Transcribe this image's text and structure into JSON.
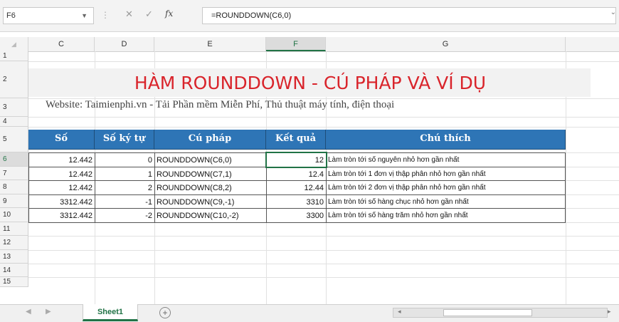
{
  "formula_bar": {
    "name_box": "F6",
    "formula": "=ROUNDDOWN(C6,0)"
  },
  "columns": [
    "C",
    "D",
    "E",
    "F",
    "G"
  ],
  "rows": [
    "1",
    "2",
    "3",
    "4",
    "5",
    "6",
    "7",
    "8",
    "9",
    "10",
    "11",
    "12",
    "13",
    "14",
    "15"
  ],
  "sheet": {
    "title": "HÀM ROUNDDOWN - CÚ PHÁP VÀ VÍ DỤ",
    "website": "Website: Taimienphi.vn - Tải Phần mềm Miễn Phí, Thủ thuật máy tính, điện thoại",
    "table": {
      "headers": [
        "Số",
        "Số ký tự",
        "Cú pháp",
        "Kết quả",
        "Chú thích"
      ],
      "rows": [
        [
          "12.442",
          "0",
          "ROUNDDOWN(C6,0)",
          "12",
          "Làm tròn tới số nguyên nhỏ hơn gần nhất"
        ],
        [
          "12.442",
          "1",
          "ROUNDDOWN(C7,1)",
          "12.4",
          "Làm tròn tới 1 đơn vị thập phân nhỏ hơn gần nhất"
        ],
        [
          "12.442",
          "2",
          "ROUNDDOWN(C8,2)",
          "12.44",
          "Làm tròn tới 2 đơn vị thập phân nhỏ hơn gần nhất"
        ],
        [
          "3312.442",
          "-1",
          "ROUNDDOWN(C9,-1)",
          "3310",
          "Làm tròn tới số hàng chục nhỏ hơn gần nhất"
        ],
        [
          "3312.442",
          "-2",
          "ROUNDDOWN(C10,-2)",
          "3300",
          "Làm tròn tới số hàng trăm nhỏ hơn gần nhất"
        ]
      ]
    }
  },
  "tabs": {
    "active": "Sheet1",
    "add": "+"
  },
  "colors": {
    "accent": "#217346",
    "title_red": "#d9242b",
    "header_blue": "#2e75b6"
  }
}
